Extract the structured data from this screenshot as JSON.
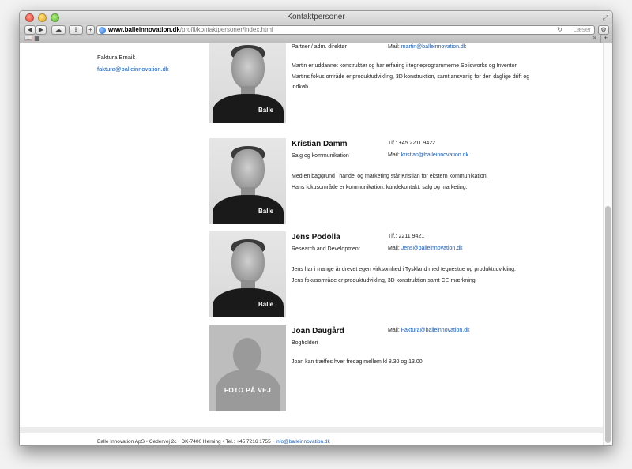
{
  "window": {
    "title": "Kontaktpersoner",
    "url_domain": "www.balleinnovation.dk",
    "url_path": "/profil/kontaktpersoner/index.html",
    "search_placeholder": "Læser"
  },
  "sidebar": {
    "faktura_label": "Faktura Email:",
    "faktura_email": "faktura@balleinnovation.dk"
  },
  "people": [
    {
      "name": "",
      "role": "Partner / adm. direktør",
      "tlf": "",
      "mail_label": "Mail:",
      "mail": "martin@balleinnovation.dk",
      "desc": [
        "Martin er uddannet konstruktør og har erfaring i tegneprogrammerne Solidworks og Inventor.",
        "Martins fokus område er produktudvikling, 3D konstruktion, samt ansvarlig for den daglige drift og",
        "indkøb."
      ],
      "photo_logo": "Balle"
    },
    {
      "name": "Kristian Damm",
      "role": "Salg og kommunikation",
      "tlf": "Tlf.: +45 2211 9422",
      "mail_label": "Mail:",
      "mail": "kristian@balleinnovation.dk",
      "desc": [
        "Med en baggrund i handel og marketing står Kristian for ekstern kommunikation.",
        "Hans fokusområde er kommunikation, kundekontakt, salg og marketing."
      ],
      "photo_logo": "Balle"
    },
    {
      "name": "Jens Podolla",
      "role": "Research and Development",
      "tlf": "Tlf.: 2211 9421",
      "mail_label": "Mail:",
      "mail": "Jens@balleinnovation.dk",
      "desc": [
        "Jens har i mange år drevet egen virksomhed i Tyskland med tegnestue og produktudvikling.",
        "Jens fokusområde er produktudvikling, 3D konstruktion samt CE-mærkning."
      ],
      "photo_logo": "Balle"
    },
    {
      "name": "Joan Daugård",
      "role": "Bogholderi",
      "tlf": "",
      "mail_label": "Mail:",
      "mail": "Faktura@balleinnovation.dk",
      "desc": [
        "Joan kan træffes hver fredag mellem kl 8.30 og 13.00."
      ],
      "placeholder_text": "FOTO PÅ VEJ"
    }
  ],
  "footer": {
    "text": "Balle Innovation ApS • Cedervej 2c • DK-7400 Herning • Tel.: +45 7216 1755 •",
    "email": "info@balleinnovation.dk"
  },
  "colors": {
    "link": "#1a5aa8"
  }
}
